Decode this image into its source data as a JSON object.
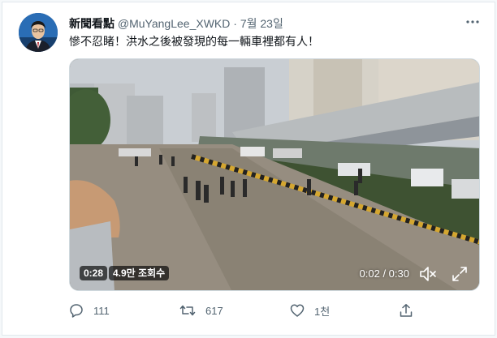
{
  "tweet": {
    "display_name": "新聞看點",
    "handle": "@MuYangLee_XWKD",
    "separator": "·",
    "date": "7월 23일",
    "text": "慘不忍睹！洪水之後被發現的每一輛車裡都有人！",
    "more_icon": "more-horizontal-icon"
  },
  "video": {
    "duration_badge": "0:28",
    "views_badge": "4.9만 조회수",
    "time_readout": "0:02 / 0:30",
    "mute_icon": "volume-muted-icon",
    "fullscreen_icon": "expand-icon"
  },
  "actions": {
    "reply_count": "111",
    "retweet_count": "617",
    "like_count": "1천",
    "share_icon": "share-icon"
  },
  "colors": {
    "text_primary": "#0f1419",
    "text_secondary": "#536471",
    "border": "#e1e8ed"
  }
}
